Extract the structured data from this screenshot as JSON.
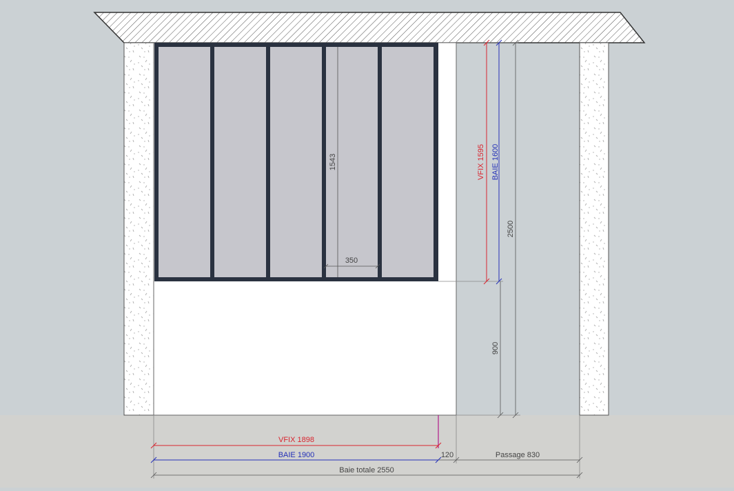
{
  "diagram": {
    "glass_height": "1543",
    "panel_width": "350",
    "vfix_height": "VFIX 1595",
    "baie_height": "BAIE 1600",
    "total_height": "2500",
    "sill_height": "900",
    "vfix_width": "VFIX 1898",
    "baie_width": "BAIE 1900",
    "gap_width": "120",
    "passage_width": "Passage 830",
    "total_width": "Baie totale 2550"
  },
  "colors": {
    "background": "#cbd1d4",
    "floor": "#d2d2cf",
    "frame": "#2a3240",
    "glass": "#c6c6cc",
    "vfix": "#d9252f",
    "baie": "#2430b8",
    "dimension": "#555555"
  }
}
